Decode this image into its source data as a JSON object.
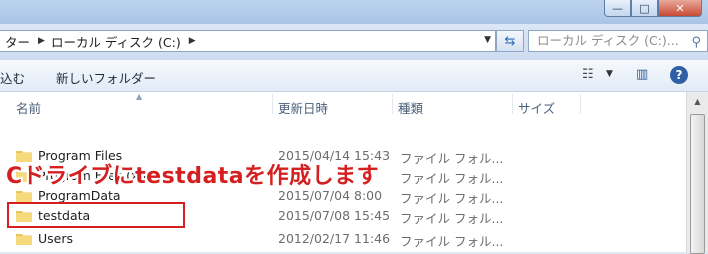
{
  "window": {
    "minimize_glyph": "—",
    "maximize_glyph": "□",
    "close_glyph": "✕"
  },
  "address": {
    "crumbs": [
      "ター",
      "ローカル ディスク (C:)"
    ],
    "search_placeholder": "ローカル ディスク (C:)..."
  },
  "toolbar": {
    "include_label": "込む",
    "new_folder_label": "新しいフォルダー"
  },
  "columns": {
    "name": "名前",
    "date": "更新日時",
    "type": "種類",
    "size": "サイズ"
  },
  "rows": [
    {
      "name": "Program Files",
      "date": "2015/04/14 15:43",
      "type": "ファイル フォル..."
    },
    {
      "name": "Program Files (x86)",
      "date": "",
      "type": "ファイル フォル..."
    },
    {
      "name": "ProgramData",
      "date": "2015/07/04 8:00",
      "type": "ファイル フォル..."
    },
    {
      "name": "testdata",
      "date": "2015/07/08 15:45",
      "type": "ファイル フォル..."
    },
    {
      "name": "Users",
      "date": "2012/02/17 11:46",
      "type": "ファイル フォル..."
    }
  ],
  "annotation": {
    "text": "Cドライブにtestdataを作成します",
    "color": "#d42020"
  },
  "icons": [
    "folder-icon",
    "refresh-icon",
    "search-icon",
    "view-options-icon",
    "preview-pane-icon",
    "help-icon"
  ]
}
